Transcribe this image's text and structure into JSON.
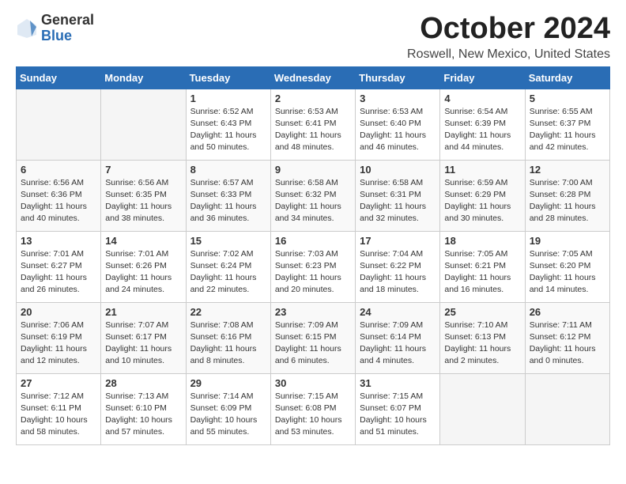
{
  "header": {
    "logo_general": "General",
    "logo_blue": "Blue",
    "month_title": "October 2024",
    "location": "Roswell, New Mexico, United States"
  },
  "weekdays": [
    "Sunday",
    "Monday",
    "Tuesday",
    "Wednesday",
    "Thursday",
    "Friday",
    "Saturday"
  ],
  "weeks": [
    [
      {
        "day": "",
        "empty": true
      },
      {
        "day": "",
        "empty": true
      },
      {
        "day": "1",
        "sunrise": "Sunrise: 6:52 AM",
        "sunset": "Sunset: 6:43 PM",
        "daylight": "Daylight: 11 hours and 50 minutes."
      },
      {
        "day": "2",
        "sunrise": "Sunrise: 6:53 AM",
        "sunset": "Sunset: 6:41 PM",
        "daylight": "Daylight: 11 hours and 48 minutes."
      },
      {
        "day": "3",
        "sunrise": "Sunrise: 6:53 AM",
        "sunset": "Sunset: 6:40 PM",
        "daylight": "Daylight: 11 hours and 46 minutes."
      },
      {
        "day": "4",
        "sunrise": "Sunrise: 6:54 AM",
        "sunset": "Sunset: 6:39 PM",
        "daylight": "Daylight: 11 hours and 44 minutes."
      },
      {
        "day": "5",
        "sunrise": "Sunrise: 6:55 AM",
        "sunset": "Sunset: 6:37 PM",
        "daylight": "Daylight: 11 hours and 42 minutes."
      }
    ],
    [
      {
        "day": "6",
        "sunrise": "Sunrise: 6:56 AM",
        "sunset": "Sunset: 6:36 PM",
        "daylight": "Daylight: 11 hours and 40 minutes."
      },
      {
        "day": "7",
        "sunrise": "Sunrise: 6:56 AM",
        "sunset": "Sunset: 6:35 PM",
        "daylight": "Daylight: 11 hours and 38 minutes."
      },
      {
        "day": "8",
        "sunrise": "Sunrise: 6:57 AM",
        "sunset": "Sunset: 6:33 PM",
        "daylight": "Daylight: 11 hours and 36 minutes."
      },
      {
        "day": "9",
        "sunrise": "Sunrise: 6:58 AM",
        "sunset": "Sunset: 6:32 PM",
        "daylight": "Daylight: 11 hours and 34 minutes."
      },
      {
        "day": "10",
        "sunrise": "Sunrise: 6:58 AM",
        "sunset": "Sunset: 6:31 PM",
        "daylight": "Daylight: 11 hours and 32 minutes."
      },
      {
        "day": "11",
        "sunrise": "Sunrise: 6:59 AM",
        "sunset": "Sunset: 6:29 PM",
        "daylight": "Daylight: 11 hours and 30 minutes."
      },
      {
        "day": "12",
        "sunrise": "Sunrise: 7:00 AM",
        "sunset": "Sunset: 6:28 PM",
        "daylight": "Daylight: 11 hours and 28 minutes."
      }
    ],
    [
      {
        "day": "13",
        "sunrise": "Sunrise: 7:01 AM",
        "sunset": "Sunset: 6:27 PM",
        "daylight": "Daylight: 11 hours and 26 minutes."
      },
      {
        "day": "14",
        "sunrise": "Sunrise: 7:01 AM",
        "sunset": "Sunset: 6:26 PM",
        "daylight": "Daylight: 11 hours and 24 minutes."
      },
      {
        "day": "15",
        "sunrise": "Sunrise: 7:02 AM",
        "sunset": "Sunset: 6:24 PM",
        "daylight": "Daylight: 11 hours and 22 minutes."
      },
      {
        "day": "16",
        "sunrise": "Sunrise: 7:03 AM",
        "sunset": "Sunset: 6:23 PM",
        "daylight": "Daylight: 11 hours and 20 minutes."
      },
      {
        "day": "17",
        "sunrise": "Sunrise: 7:04 AM",
        "sunset": "Sunset: 6:22 PM",
        "daylight": "Daylight: 11 hours and 18 minutes."
      },
      {
        "day": "18",
        "sunrise": "Sunrise: 7:05 AM",
        "sunset": "Sunset: 6:21 PM",
        "daylight": "Daylight: 11 hours and 16 minutes."
      },
      {
        "day": "19",
        "sunrise": "Sunrise: 7:05 AM",
        "sunset": "Sunset: 6:20 PM",
        "daylight": "Daylight: 11 hours and 14 minutes."
      }
    ],
    [
      {
        "day": "20",
        "sunrise": "Sunrise: 7:06 AM",
        "sunset": "Sunset: 6:19 PM",
        "daylight": "Daylight: 11 hours and 12 minutes."
      },
      {
        "day": "21",
        "sunrise": "Sunrise: 7:07 AM",
        "sunset": "Sunset: 6:17 PM",
        "daylight": "Daylight: 11 hours and 10 minutes."
      },
      {
        "day": "22",
        "sunrise": "Sunrise: 7:08 AM",
        "sunset": "Sunset: 6:16 PM",
        "daylight": "Daylight: 11 hours and 8 minutes."
      },
      {
        "day": "23",
        "sunrise": "Sunrise: 7:09 AM",
        "sunset": "Sunset: 6:15 PM",
        "daylight": "Daylight: 11 hours and 6 minutes."
      },
      {
        "day": "24",
        "sunrise": "Sunrise: 7:09 AM",
        "sunset": "Sunset: 6:14 PM",
        "daylight": "Daylight: 11 hours and 4 minutes."
      },
      {
        "day": "25",
        "sunrise": "Sunrise: 7:10 AM",
        "sunset": "Sunset: 6:13 PM",
        "daylight": "Daylight: 11 hours and 2 minutes."
      },
      {
        "day": "26",
        "sunrise": "Sunrise: 7:11 AM",
        "sunset": "Sunset: 6:12 PM",
        "daylight": "Daylight: 11 hours and 0 minutes."
      }
    ],
    [
      {
        "day": "27",
        "sunrise": "Sunrise: 7:12 AM",
        "sunset": "Sunset: 6:11 PM",
        "daylight": "Daylight: 10 hours and 58 minutes."
      },
      {
        "day": "28",
        "sunrise": "Sunrise: 7:13 AM",
        "sunset": "Sunset: 6:10 PM",
        "daylight": "Daylight: 10 hours and 57 minutes."
      },
      {
        "day": "29",
        "sunrise": "Sunrise: 7:14 AM",
        "sunset": "Sunset: 6:09 PM",
        "daylight": "Daylight: 10 hours and 55 minutes."
      },
      {
        "day": "30",
        "sunrise": "Sunrise: 7:15 AM",
        "sunset": "Sunset: 6:08 PM",
        "daylight": "Daylight: 10 hours and 53 minutes."
      },
      {
        "day": "31",
        "sunrise": "Sunrise: 7:15 AM",
        "sunset": "Sunset: 6:07 PM",
        "daylight": "Daylight: 10 hours and 51 minutes."
      },
      {
        "day": "",
        "empty": true
      },
      {
        "day": "",
        "empty": true
      }
    ]
  ]
}
